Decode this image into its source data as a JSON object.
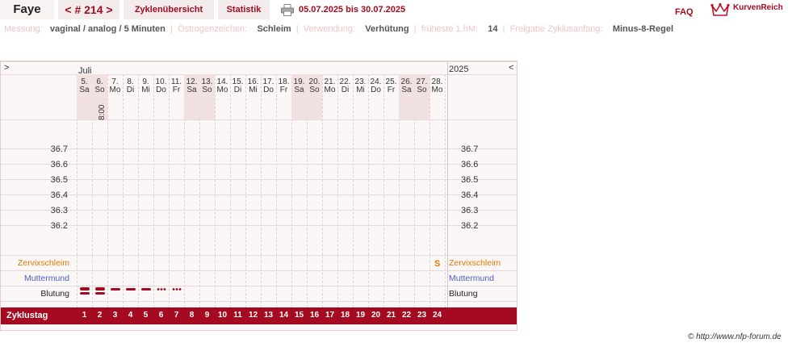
{
  "header": {
    "name": "Faye",
    "cycle": "< # 214 >",
    "tab_overview": "Zyklenübersicht",
    "tab_stats": "Statistik",
    "date_range": "05.07.2025 bis 30.07.2025",
    "faq": "FAQ",
    "logo_text": "KurvenReich",
    "accent": "#a50b20"
  },
  "info": {
    "messung_label": "Messung:",
    "messung_value": "vaginal / analog / 5 Minuten",
    "oestrogen_label": "Östrogenzeichen:",
    "oestrogen_value": "Schleim",
    "verwendung_label": "Verwendung:",
    "verwendung_value": "Verhütung",
    "fruehste_label": "früheste 1.hM:",
    "fruehste_value": "14",
    "freigabe_label": "Freigabe Zyklusanfang:",
    "freigabe_value": "Minus-8-Regel"
  },
  "chart": {
    "nav_prev": ">",
    "nav_next": "<",
    "month": "Juli",
    "year": "2025",
    "days": [
      {
        "num": "5.",
        "wd": "Sa",
        "weekend": true
      },
      {
        "num": "6.",
        "wd": "So",
        "weekend": true
      },
      {
        "num": "7.",
        "wd": "Mo",
        "weekend": false
      },
      {
        "num": "8.",
        "wd": "Di",
        "weekend": false
      },
      {
        "num": "9.",
        "wd": "Mi",
        "weekend": false
      },
      {
        "num": "10.",
        "wd": "Do",
        "weekend": false
      },
      {
        "num": "11.",
        "wd": "Fr",
        "weekend": false
      },
      {
        "num": "12.",
        "wd": "Sa",
        "weekend": true
      },
      {
        "num": "13.",
        "wd": "So",
        "weekend": true
      },
      {
        "num": "14.",
        "wd": "Mo",
        "weekend": false
      },
      {
        "num": "15.",
        "wd": "Di",
        "weekend": false
      },
      {
        "num": "16.",
        "wd": "Mi",
        "weekend": false
      },
      {
        "num": "17.",
        "wd": "Do",
        "weekend": false
      },
      {
        "num": "18.",
        "wd": "Fr",
        "weekend": false
      },
      {
        "num": "19.",
        "wd": "Sa",
        "weekend": true
      },
      {
        "num": "20.",
        "wd": "So",
        "weekend": true
      },
      {
        "num": "21.",
        "wd": "Mo",
        "weekend": false
      },
      {
        "num": "22.",
        "wd": "Di",
        "weekend": false
      },
      {
        "num": "23.",
        "wd": "Mi",
        "weekend": false
      },
      {
        "num": "24.",
        "wd": "Do",
        "weekend": false
      },
      {
        "num": "25.",
        "wd": "Fr",
        "weekend": false
      },
      {
        "num": "26.",
        "wd": "Sa",
        "weekend": true
      },
      {
        "num": "27.",
        "wd": "So",
        "weekend": true
      },
      {
        "num": "28.",
        "wd": "Mo",
        "weekend": false
      }
    ],
    "time_note": "8:00",
    "temps": [
      "36.7",
      "36.6",
      "36.5",
      "36.4",
      "36.3",
      "36.2"
    ],
    "row_cervix": "Zervixschleim",
    "row_cervix_color": "#e07b00",
    "row_muttermund": "Muttermund",
    "row_muttermund_color": "#4a5fc1",
    "row_blutung": "Blutung",
    "cervix_mark": "S",
    "bleeding": [
      "heavy",
      "heavy",
      "medium",
      "medium",
      "medium",
      "light",
      "light"
    ],
    "cycle_label": "Zyklustag",
    "cycle_days": [
      "1",
      "2",
      "3",
      "4",
      "5",
      "6",
      "7",
      "8",
      "9",
      "10",
      "11",
      "12",
      "13",
      "14",
      "15",
      "16",
      "17",
      "18",
      "19",
      "20",
      "21",
      "22",
      "23",
      "24"
    ]
  },
  "footer": {
    "copyright": "© http://www.nfp-forum.de"
  }
}
